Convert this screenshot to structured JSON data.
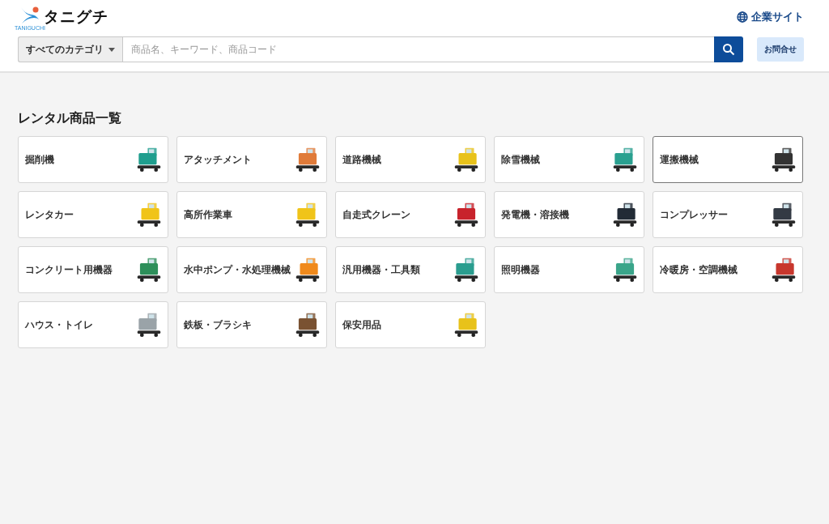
{
  "header": {
    "logo_text": "タニグチ",
    "logo_subtext": "TANIGUCHI",
    "corporate_link": "企業サイト",
    "contact_button": "お問合せ"
  },
  "search": {
    "category": "すべてのカテゴリ",
    "placeholder": "商品名、キーワード、商品コード"
  },
  "section_title": "レンタル商品一覧",
  "categories": [
    {
      "label": "掘削機",
      "selected": false
    },
    {
      "label": "アタッチメント",
      "selected": false
    },
    {
      "label": "道路機械",
      "selected": false
    },
    {
      "label": "除雪機械",
      "selected": false
    },
    {
      "label": "運搬機械",
      "selected": true
    },
    {
      "label": "レンタカー",
      "selected": false
    },
    {
      "label": "高所作業車",
      "selected": false
    },
    {
      "label": "自走式クレーン",
      "selected": false
    },
    {
      "label": "発電機・溶接機",
      "selected": false
    },
    {
      "label": "コンプレッサー",
      "selected": false
    },
    {
      "label": "コンクリート用機器",
      "selected": false
    },
    {
      "label": "水中ポンプ・水処理機械",
      "selected": false
    },
    {
      "label": "汎用機器・工具類",
      "selected": false
    },
    {
      "label": "照明機器",
      "selected": false
    },
    {
      "label": "冷暖房・空調機械",
      "selected": false
    },
    {
      "label": "ハウス・トイレ",
      "selected": false
    },
    {
      "label": "鉄板・ブラシキ",
      "selected": false
    },
    {
      "label": "保安用品",
      "selected": false
    }
  ]
}
